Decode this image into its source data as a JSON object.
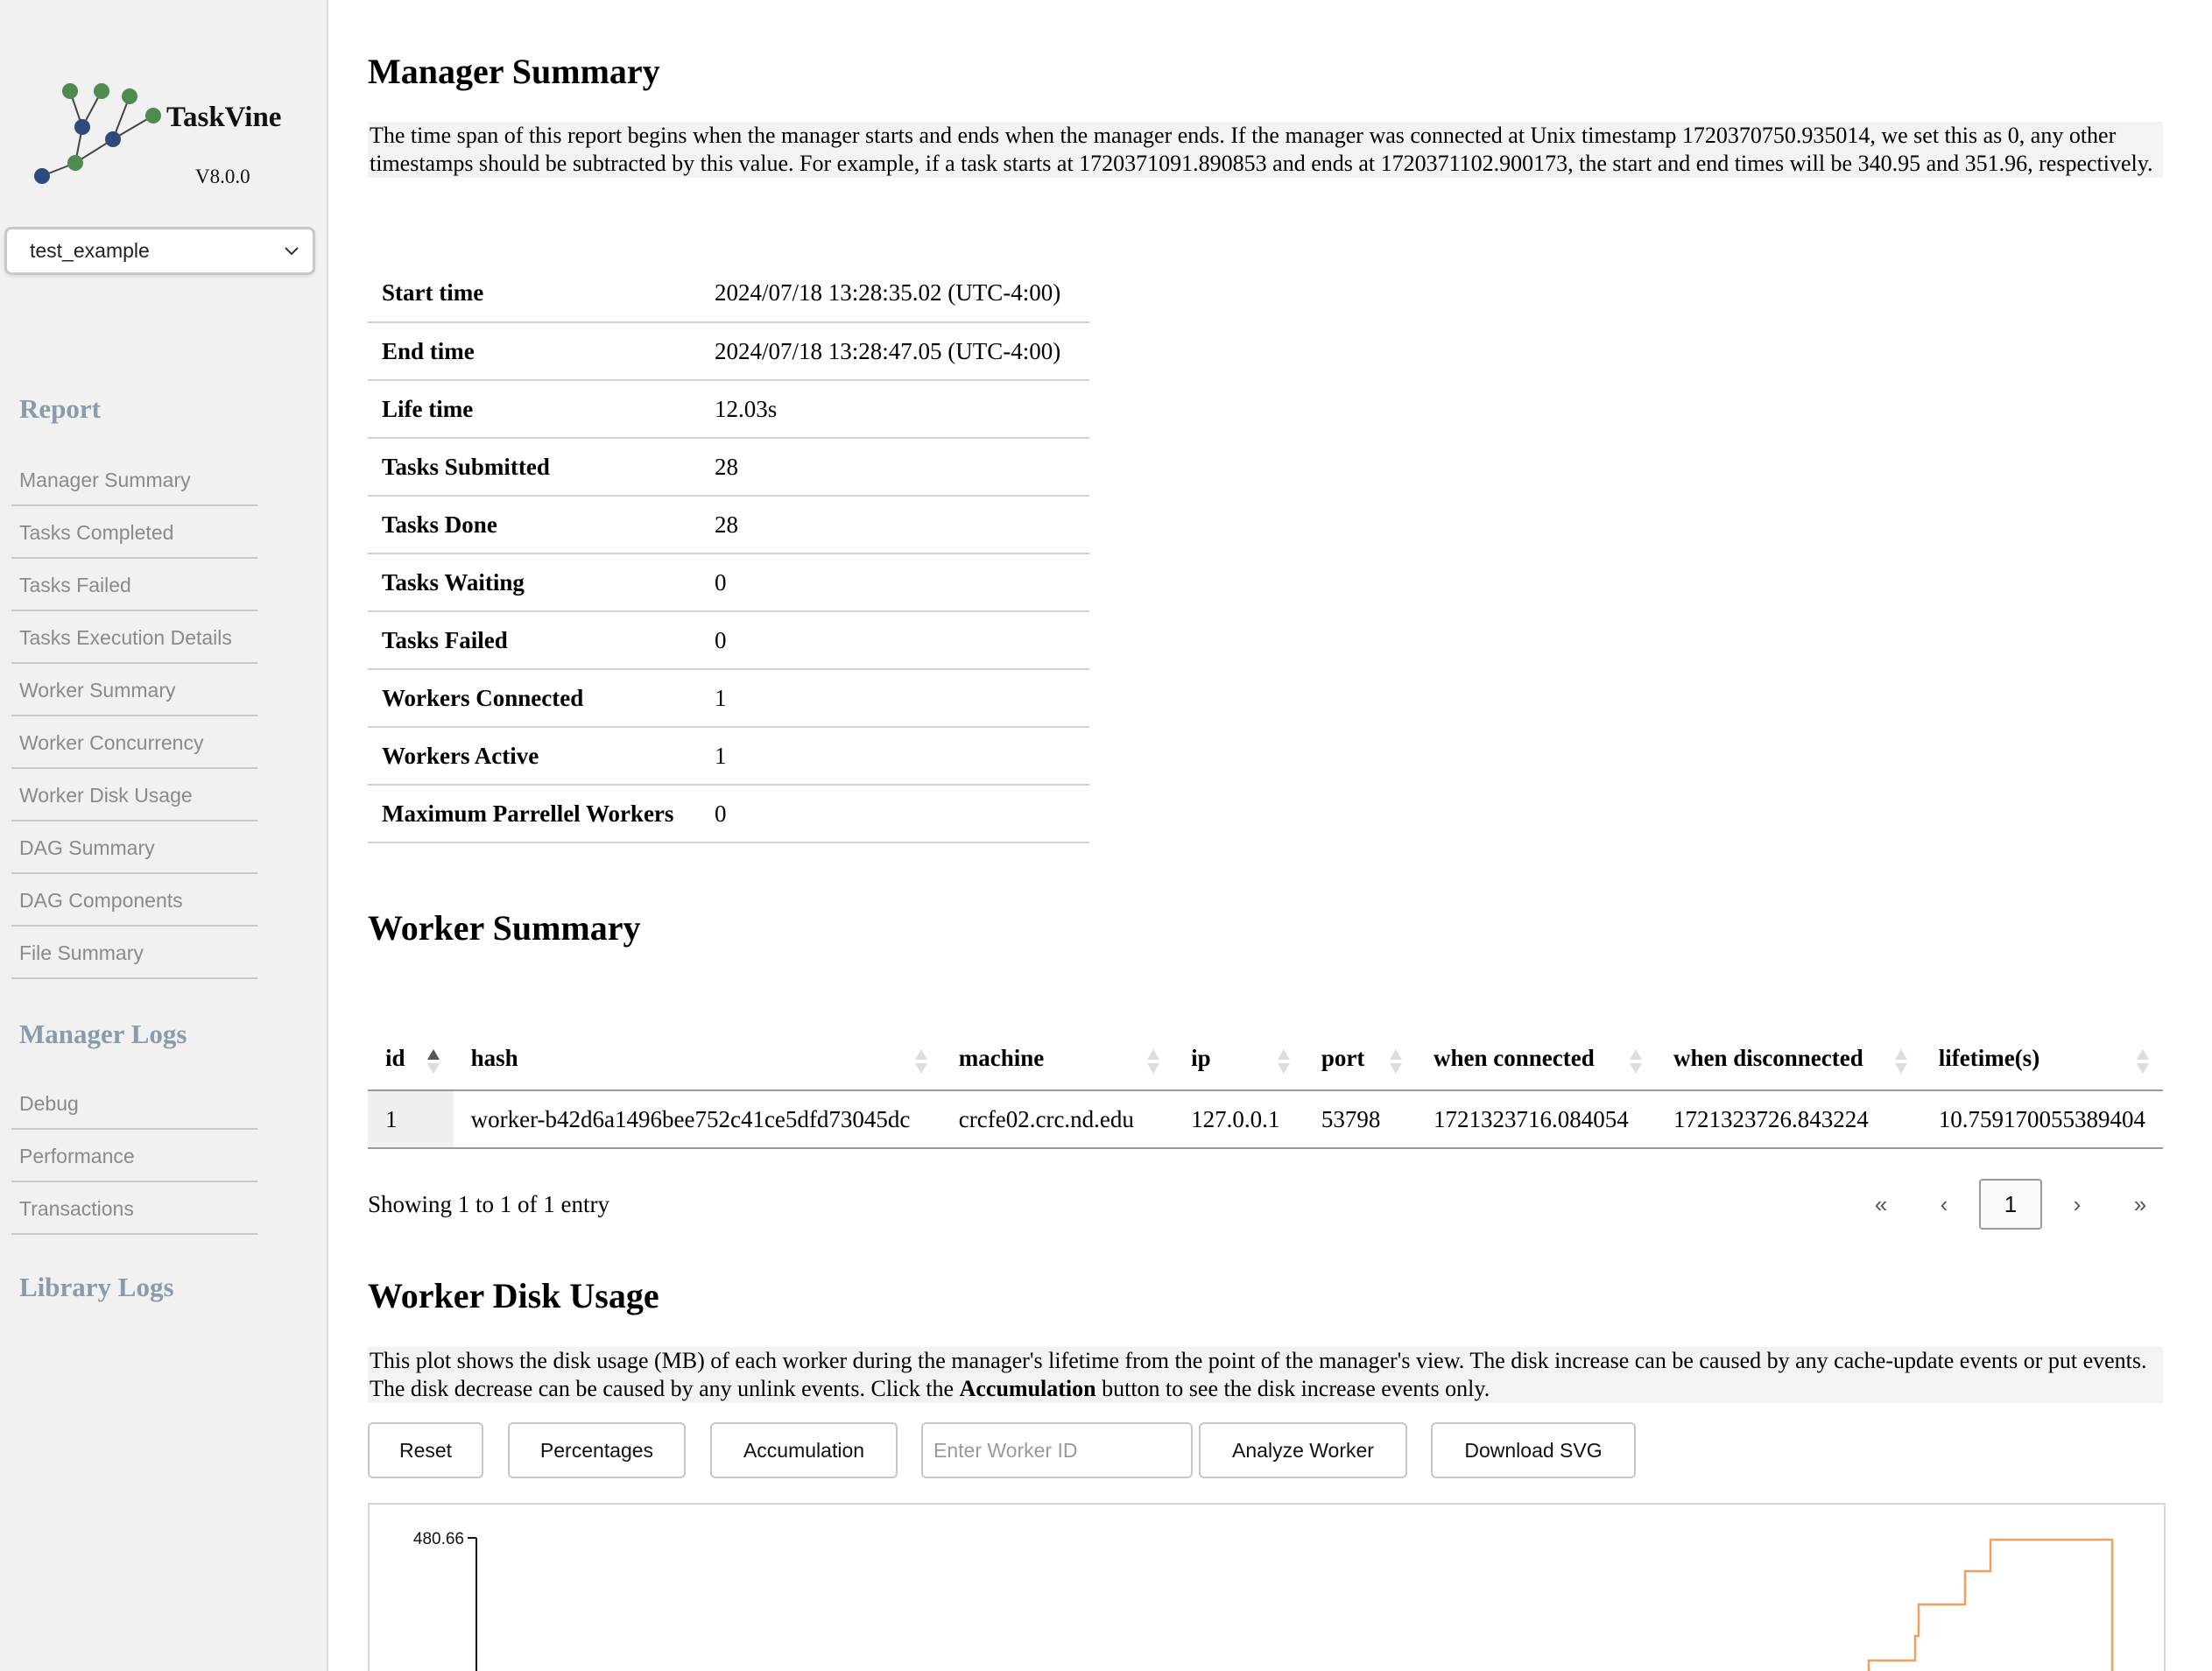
{
  "sidebar": {
    "app_name": "TaskVine",
    "version": "V8.0.0",
    "log_selector": {
      "selected": "test_example"
    },
    "sections": [
      {
        "heading": "Report",
        "items": [
          "Manager Summary",
          "Tasks Completed",
          "Tasks Failed",
          "Tasks Execution Details",
          "Worker Summary",
          "Worker Concurrency",
          "Worker Disk Usage",
          "DAG Summary",
          "DAG Components",
          "File Summary"
        ]
      },
      {
        "heading": "Manager Logs",
        "items": [
          "Debug",
          "Performance",
          "Transactions"
        ]
      },
      {
        "heading": "Library Logs",
        "items": []
      }
    ]
  },
  "manager_summary": {
    "title": "Manager Summary",
    "description": "The time span of this report begins when the manager starts and ends when the manager ends. If the manager was connected at Unix timestamp 1720370750.935014, we set this as 0, any other timestamps should be subtracted by this value. For example, if a task starts at 1720371091.890853 and ends at 1720371102.900173, the start and end times will be 340.95 and 351.96, respectively.",
    "rows": [
      {
        "key": "Start time",
        "value": "2024/07/18 13:28:35.02 (UTC-4:00)"
      },
      {
        "key": "End time",
        "value": "2024/07/18 13:28:47.05 (UTC-4:00)"
      },
      {
        "key": "Life time",
        "value": "12.03s"
      },
      {
        "key": "Tasks Submitted",
        "value": "28"
      },
      {
        "key": "Tasks Done",
        "value": "28"
      },
      {
        "key": "Tasks Waiting",
        "value": "0"
      },
      {
        "key": "Tasks Failed",
        "value": "0"
      },
      {
        "key": "Workers Connected",
        "value": "1"
      },
      {
        "key": "Workers Active",
        "value": "1"
      },
      {
        "key": "Maximum Parrellel Workers",
        "value": "0"
      }
    ]
  },
  "worker_summary": {
    "title": "Worker Summary",
    "columns": [
      "id",
      "hash",
      "machine",
      "ip",
      "port",
      "when connected",
      "when disconnected",
      "lifetime(s)"
    ],
    "rows": [
      [
        "1",
        "worker-b42d6a1496bee752c41ce5dfd73045dc",
        "crcfe02.crc.nd.edu",
        "127.0.0.1",
        "53798",
        "1721323716.084054",
        "1721323726.843224",
        "10.759170055389404"
      ]
    ],
    "showing": "Showing 1 to 1 of 1 entry",
    "pagination": {
      "first": "«",
      "prev": "‹",
      "current": "1",
      "next": "›",
      "last": "»"
    }
  },
  "worker_disk_usage": {
    "title": "Worker Disk Usage",
    "description_before": "This plot shows the disk usage (MB) of each worker during the manager's lifetime from the point of the manager's view. The disk increase can be caused by any cache-update events or put events. The disk decrease can be caused by any unlink events. Click the ",
    "description_bold": "Accumulation",
    "description_after": " button to see the disk increase events only.",
    "buttons": {
      "reset": "Reset",
      "percentages": "Percentages",
      "accumulation": "Accumulation",
      "worker_id_placeholder": "Enter Worker ID",
      "analyze": "Analyze Worker",
      "download": "Download SVG"
    },
    "plot": {
      "y_max_label": "480.66",
      "line_color": "#f0a060"
    }
  }
}
